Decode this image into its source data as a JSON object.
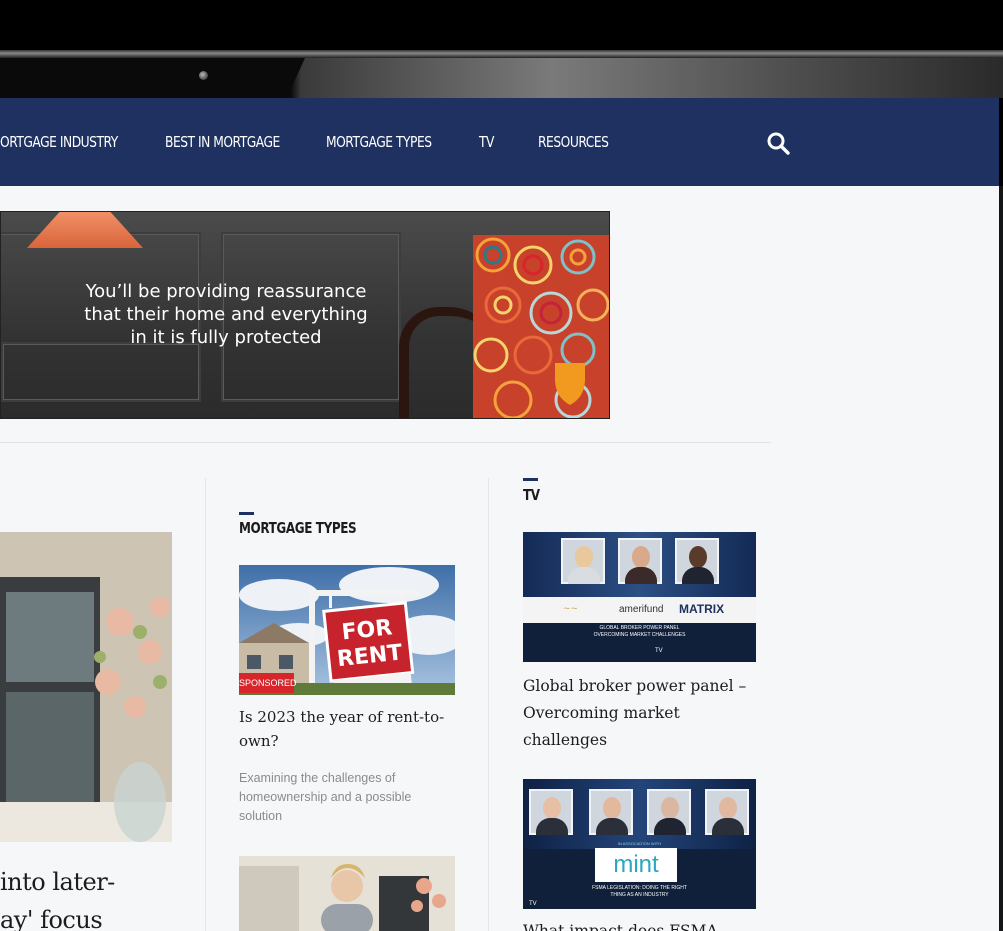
{
  "nav": {
    "items": [
      {
        "label": "ORTGAGE INDUSTRY"
      },
      {
        "label": "BEST IN MORTGAGE"
      },
      {
        "label": "MORTGAGE TYPES"
      },
      {
        "label": "TV"
      },
      {
        "label": "RESOURCES"
      }
    ],
    "search_icon": "search-icon"
  },
  "banner": {
    "line1": "You’ll be providing reassurance",
    "line2": "that their home and everything",
    "line3": "in it is fully protected"
  },
  "feature": {
    "title_line1": "into later-",
    "title_line2": "ay' focus"
  },
  "mortgage_types": {
    "heading": "MORTGAGE TYPES",
    "article": {
      "image_sign_line1": "FOR",
      "image_sign_line2": "RENT",
      "badge": "SPONSORED",
      "title": "Is 2023 the year of rent-to-own?",
      "description": "Examining the challenges of homeownership and a possible solution"
    }
  },
  "tv": {
    "heading": "TV",
    "videos": [
      {
        "title": "Global broker power panel – Overcoming market challenges",
        "sponsor1": "amerifund",
        "sponsor2": "MATRIX",
        "caption_line1": "GLOBAL BROKER POWER PANEL",
        "caption_line2": "OVERCOMING MARKET CHALLENGES",
        "footer": "TV"
      },
      {
        "title": "What impact does FSMA",
        "partner_caption": "IN ASSOCIATION WITH",
        "partner_logo": "mint",
        "caption_line1": "FSMA LEGISLATION: DOING THE RIGHT",
        "caption_line2": "THING AS AN INDUSTRY",
        "footer": "TV"
      }
    ]
  }
}
